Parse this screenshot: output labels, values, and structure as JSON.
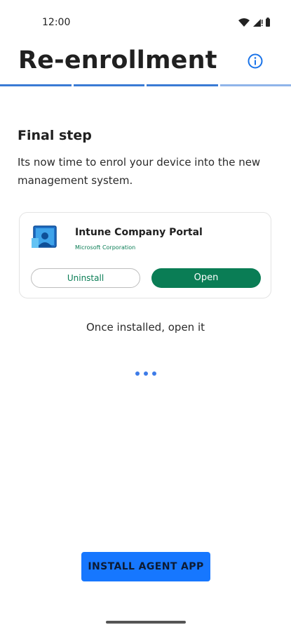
{
  "status_bar": {
    "time": "12:00",
    "icons": [
      "wifi-icon",
      "signal-icon",
      "battery-icon"
    ]
  },
  "header": {
    "title": "Re-enrollment",
    "info_icon": "info-icon"
  },
  "progress": {
    "total_steps": 4,
    "completed_steps": 3,
    "active_color": "#3a7bd5",
    "inactive_color": "#8fb4ea"
  },
  "step": {
    "title": "Final step",
    "description": "Its now time to enrol your device into the new management system."
  },
  "app_card": {
    "name": "Intune Company Portal",
    "publisher": "Microsoft Corporation",
    "uninstall_label": "Uninstall",
    "open_label": "Open"
  },
  "hint": "Once installed, open it",
  "actions": {
    "install_label": "INSTALL AGENT APP"
  },
  "colors": {
    "accent_blue": "#1677ff",
    "brand_green": "#0a7d55",
    "loading_dots": "#3d7be8"
  }
}
